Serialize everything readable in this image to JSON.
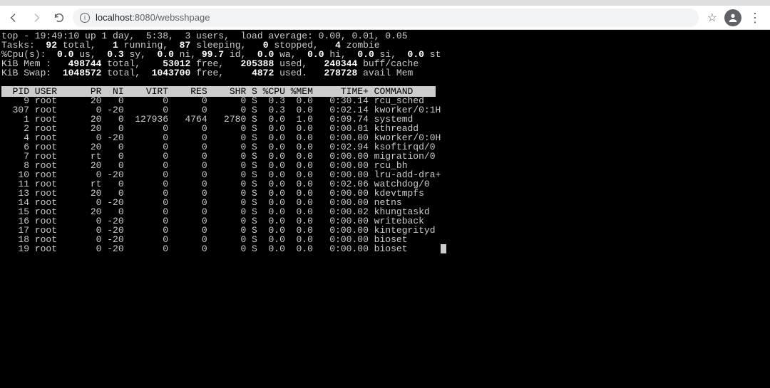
{
  "browser": {
    "url_host": "localhost",
    "url_port_path": ":8080/websshpage"
  },
  "term": {
    "line1": "top - 19:49:10 up 1 day,  5:38,  3 users,  load average: 0.00, 0.01, 0.05",
    "line2_a": "Tasks:",
    "line2_b": "  92 ",
    "line2_c": "total,",
    "line2_d": "   1 ",
    "line2_e": "running,",
    "line2_f": "  87 ",
    "line2_g": "sleeping,",
    "line2_h": "   0 ",
    "line2_i": "stopped,",
    "line2_j": "   4 ",
    "line2_k": "zombie",
    "line3_a": "%Cpu(s):",
    "line3_b": "  0.0 ",
    "line3_c": "us,",
    "line3_d": "  0.3 ",
    "line3_e": "sy,",
    "line3_f": "  0.0 ",
    "line3_g": "ni,",
    "line3_h": " 99.7 ",
    "line3_i": "id,",
    "line3_j": "  0.0 ",
    "line3_k": "wa,",
    "line3_l": "  0.0 ",
    "line3_m": "hi,",
    "line3_n": "  0.0 ",
    "line3_o": "si,",
    "line3_p": "  0.0 ",
    "line3_q": "st",
    "line4_a": "KiB Mem :",
    "line4_b": "   498744 ",
    "line4_c": "total,",
    "line4_d": "    53012 ",
    "line4_e": "free,",
    "line4_f": "   205388 ",
    "line4_g": "used,",
    "line4_h": "   240344 ",
    "line4_i": "buff/cache",
    "line5_a": "KiB Swap:",
    "line5_b": "  1048572 ",
    "line5_c": "total,",
    "line5_d": "  1043700 ",
    "line5_e": "free,",
    "line5_f": "     4872 ",
    "line5_g": "used.",
    "line5_h": "   278728 ",
    "line5_i": "avail Mem",
    "header": "  PID USER      PR  NI    VIRT    RES    SHR S %CPU %MEM     TIME+ COMMAND    ",
    "rows": [
      "    9 root      20   0       0      0      0 S  0.3  0.0   0:30.14 rcu_sched",
      "  307 root       0 -20       0      0      0 S  0.3  0.0   0:02.14 kworker/0:1H",
      "    1 root      20   0  127936   4764   2780 S  0.0  1.0   0:09.74 systemd",
      "    2 root      20   0       0      0      0 S  0.0  0.0   0:00.01 kthreadd",
      "    4 root       0 -20       0      0      0 S  0.0  0.0   0:00.00 kworker/0:0H",
      "    6 root      20   0       0      0      0 S  0.0  0.0   0:02.94 ksoftirqd/0",
      "    7 root      rt   0       0      0      0 S  0.0  0.0   0:00.00 migration/0",
      "    8 root      20   0       0      0      0 S  0.0  0.0   0:00.00 rcu_bh",
      "   10 root       0 -20       0      0      0 S  0.0  0.0   0:00.00 lru-add-dra+",
      "   11 root      rt   0       0      0      0 S  0.0  0.0   0:02.06 watchdog/0",
      "   13 root      20   0       0      0      0 S  0.0  0.0   0:00.00 kdevtmpfs",
      "   14 root       0 -20       0      0      0 S  0.0  0.0   0:00.00 netns",
      "   15 root      20   0       0      0      0 S  0.0  0.0   0:00.02 khungtaskd",
      "   16 root       0 -20       0      0      0 S  0.0  0.0   0:00.00 writeback",
      "   17 root       0 -20       0      0      0 S  0.0  0.0   0:00.00 kintegrityd",
      "   18 root       0 -20       0      0      0 S  0.0  0.0   0:00.00 bioset",
      "   19 root       0 -20       0      0      0 S  0.0  0.0   0:00.00 bioset"
    ]
  }
}
